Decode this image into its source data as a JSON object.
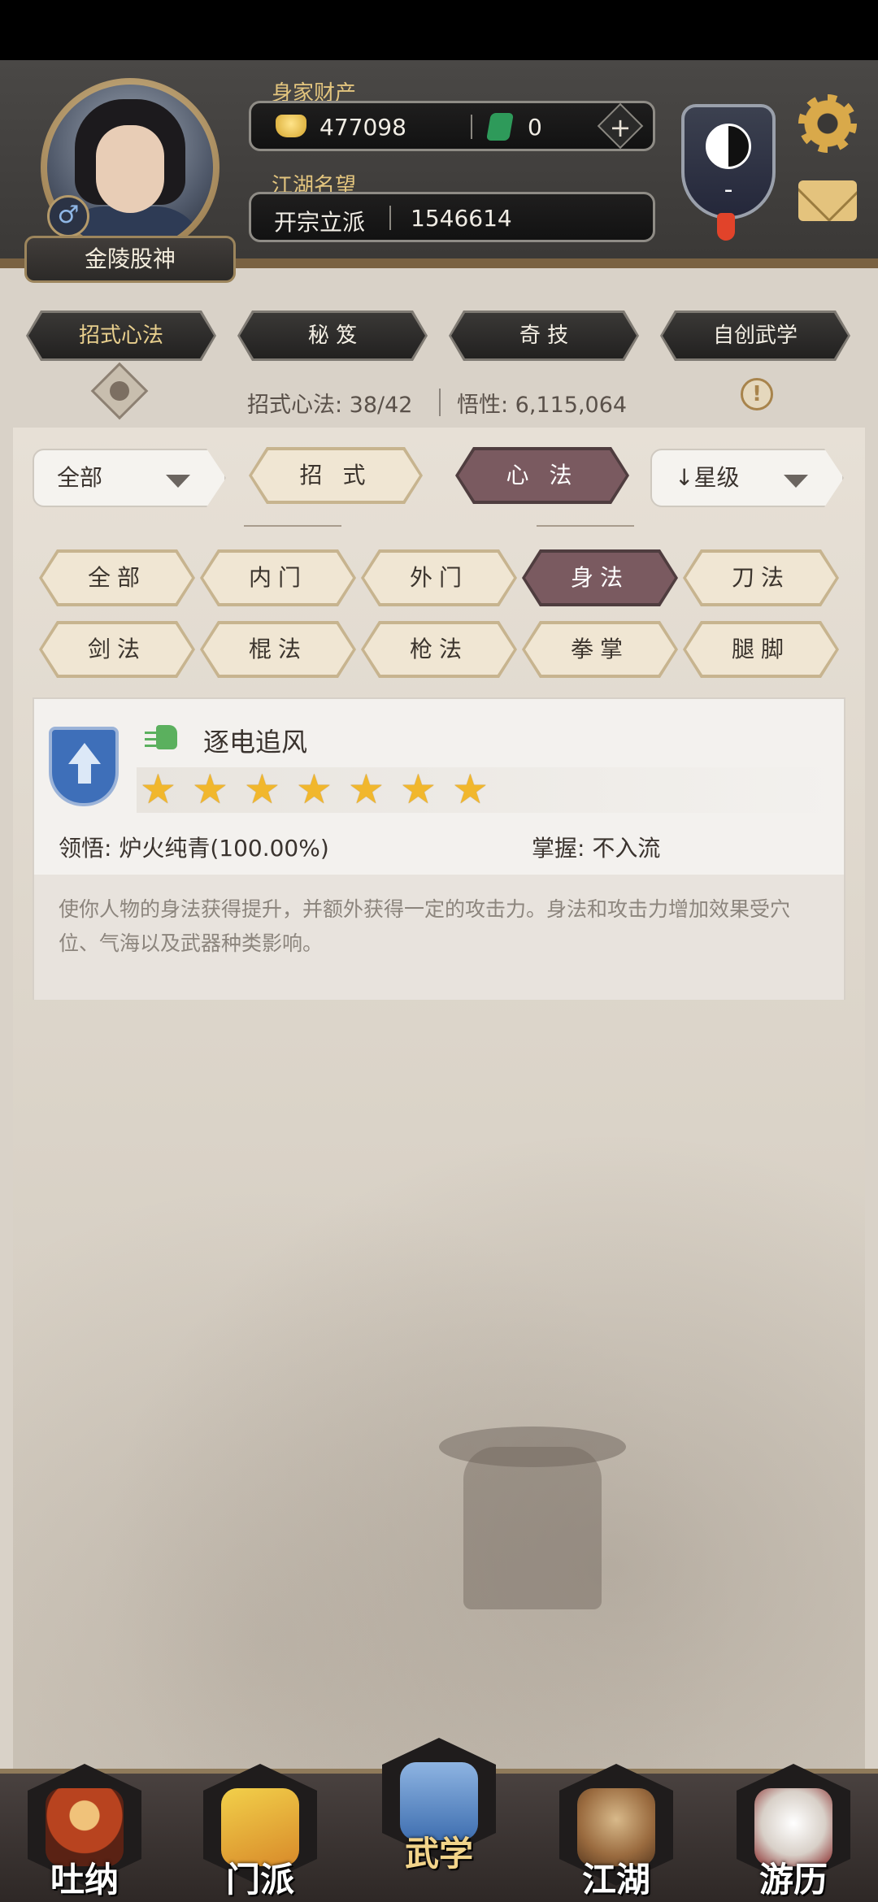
{
  "header": {
    "player_name": "金陵股神",
    "gender_symbol": "♂",
    "wealth_label": "身家财产",
    "gold_amount": "477098",
    "jade_amount": "0",
    "plus_symbol": "+",
    "reputation_label": "江湖名望",
    "reputation_title": "开宗立派",
    "reputation_value": "1546614",
    "taiji_level": "-"
  },
  "top_tabs": [
    {
      "label": "招式心法",
      "active": true
    },
    {
      "label": "秘 笈",
      "active": false
    },
    {
      "label": "奇 技",
      "active": false
    },
    {
      "label": "自创武学",
      "active": false
    }
  ],
  "stats": {
    "techniques": "招式心法: 38/42",
    "comprehension": "悟性: 6,115,064",
    "warning_symbol": "!"
  },
  "filters": {
    "category_dropdown": "全部",
    "type_tabs": [
      {
        "label": "招 式",
        "selected": false
      },
      {
        "label": "心 法",
        "selected": true
      }
    ],
    "sort_dropdown": "↓星级"
  },
  "subcategories": [
    {
      "label": "全部",
      "selected": false
    },
    {
      "label": "内门",
      "selected": false
    },
    {
      "label": "外门",
      "selected": false
    },
    {
      "label": "身法",
      "selected": true
    },
    {
      "label": "刀法",
      "selected": false
    },
    {
      "label": "剑法",
      "selected": false
    },
    {
      "label": "棍法",
      "selected": false
    },
    {
      "label": "枪法",
      "selected": false
    },
    {
      "label": "拳掌",
      "selected": false
    },
    {
      "label": "腿脚",
      "selected": false
    }
  ],
  "skill_card": {
    "name": "逐电追风",
    "stars": 7,
    "star_glyph": "★",
    "comprehension": "领悟: 炉火纯青(100.00%)",
    "mastery": "掌握: 不入流",
    "description": "使你人物的身法获得提升，并额外获得一定的攻击力。身法和攻击力增加效果受穴位、气海以及武器种类影响。"
  },
  "bottom_nav": [
    {
      "label": "吐纳",
      "active": false,
      "color": "#b8431f"
    },
    {
      "label": "门派",
      "active": false,
      "color": "#d9b23a"
    },
    {
      "label": "武学",
      "active": true,
      "color": "#3f6fb0"
    },
    {
      "label": "江湖",
      "active": false,
      "color": "#9a6b3f"
    },
    {
      "label": "游历",
      "active": false,
      "color": "#e8e2dc"
    }
  ],
  "colors": {
    "accent_gold": "#e3c57e",
    "selected_tab": "#7a5a60",
    "star": "#f1b72d"
  }
}
